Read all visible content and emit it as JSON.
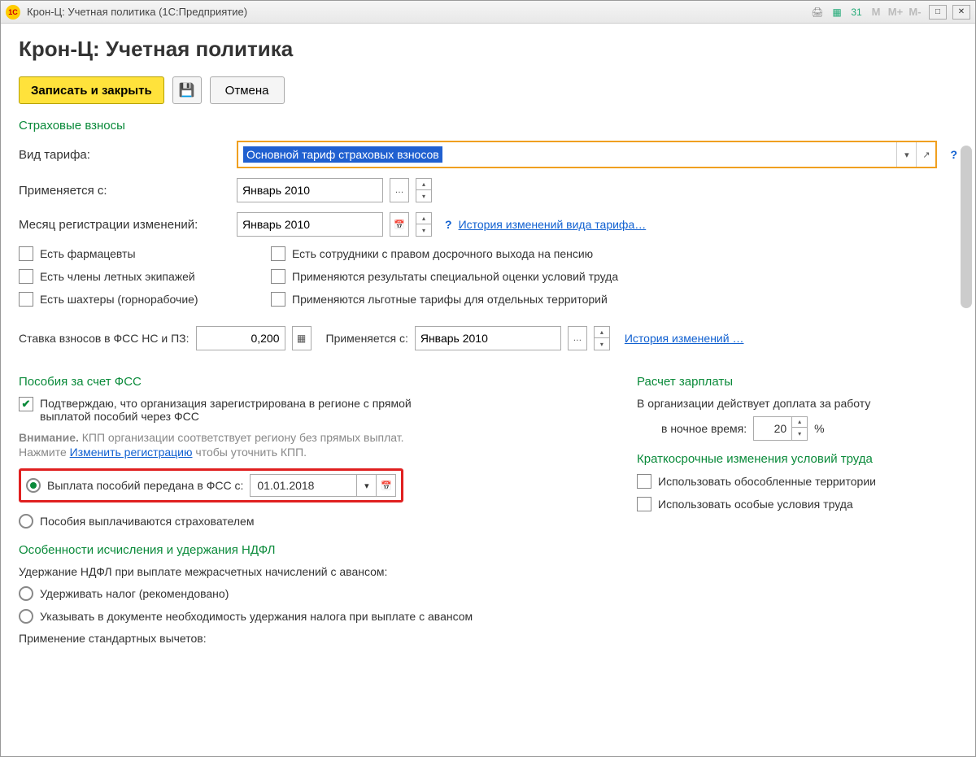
{
  "titlebar": {
    "title": "Крон-Ц: Учетная политика  (1С:Предприятие)",
    "logo": "1C"
  },
  "page": {
    "title": "Крон-Ц: Учетная политика"
  },
  "toolbar": {
    "save_close": "Записать и закрыть",
    "cancel": "Отмена"
  },
  "insurance": {
    "section": "Страховые взносы",
    "tariff_label": "Вид тарифа:",
    "tariff_value": "Основной тариф страховых взносов",
    "applies_from_label": "Применяется с:",
    "applies_from_value": "Январь 2010",
    "reg_month_label": "Месяц регистрации изменений:",
    "reg_month_value": "Январь 2010",
    "history_link": "История изменений вида тарифа…",
    "cb_pharma": "Есть фармацевты",
    "cb_flight": "Есть члены летных экипажей",
    "cb_miners": "Есть шахтеры (горнорабочие)",
    "cb_pension": "Есть сотрудники с правом досрочного выхода на пенсию",
    "cb_spec": "Применяются результаты специальной оценки условий труда",
    "cb_terr": "Применяются льготные тарифы для отдельных территорий",
    "fss_rate_label": "Ставка взносов в ФСС НС и ПЗ:",
    "fss_rate_value": "0,200",
    "fss_applies_label": "Применяется с:",
    "fss_applies_value": "Январь 2010",
    "fss_history": "История изменений …"
  },
  "fss": {
    "section": "Пособия за счет ФСС",
    "confirm": "Подтверждаю, что организация зарегистрирована в регионе с прямой выплатой пособий через ФСС",
    "warning_bold": "Внимание.",
    "warning_text1": " КПП организации соответствует региону без прямых выплат.",
    "warning_text2": "Нажмите ",
    "warning_link": "Изменить регистрацию",
    "warning_text3": " чтобы уточнить КПП.",
    "radio_fss": "Выплата пособий передана в ФСС с:",
    "radio_fss_date": "01.01.2018",
    "radio_insurer": "Пособия выплачиваются страхователем"
  },
  "salary": {
    "section": "Расчет зарплаты",
    "night_text1": "В организации действует доплата за работу",
    "night_text2": "в ночное время:",
    "night_value": "20",
    "night_suffix": "%",
    "short_section": "Краткосрочные изменения условий труда",
    "cb_terr": "Использовать обособленные территории",
    "cb_cond": "Использовать особые условия труда"
  },
  "ndfl": {
    "section": "Особенности исчисления и удержания НДФЛ",
    "subtitle": "Удержание НДФЛ при выплате межрасчетных начислений с авансом:",
    "radio_rec": "Удерживать налог (рекомендовано)",
    "radio_doc": "Указывать в документе необходимость удержания налога при выплате с авансом",
    "deductions": "Применение стандартных вычетов:"
  }
}
